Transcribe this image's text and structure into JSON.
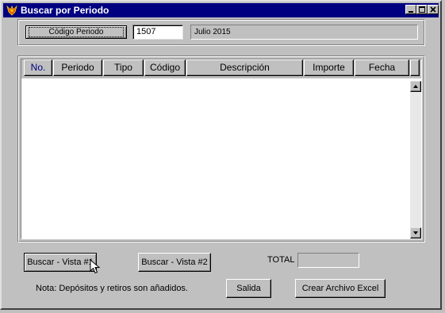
{
  "window": {
    "title": "Buscar por Periodo",
    "controls": {
      "minimize": "_",
      "maximize": "□",
      "close": "×"
    }
  },
  "period": {
    "code_button_label": "Código Periodo",
    "code_value": "1507",
    "description": "Julio 2015"
  },
  "table": {
    "columns": [
      "No.",
      "Periodo",
      "Tipo",
      "Código",
      "Descripción",
      "Importe",
      "Fecha"
    ],
    "rows": []
  },
  "buttons": {
    "search_view1": "Buscar - Vista #1",
    "search_view2": "Buscar - Vista #2",
    "exit": "Salida",
    "excel": "Crear Archivo Excel"
  },
  "total": {
    "label": "TOTAL",
    "value": ""
  },
  "note": "Nota: Depósitos y retiros son añadidos.",
  "colors": {
    "titlebar": "#000080",
    "face": "#c0c0c0",
    "no_column_text": "#000080"
  },
  "icons": {
    "app": "app-logo-icon",
    "cursor": "mouse-pointer-icon"
  }
}
